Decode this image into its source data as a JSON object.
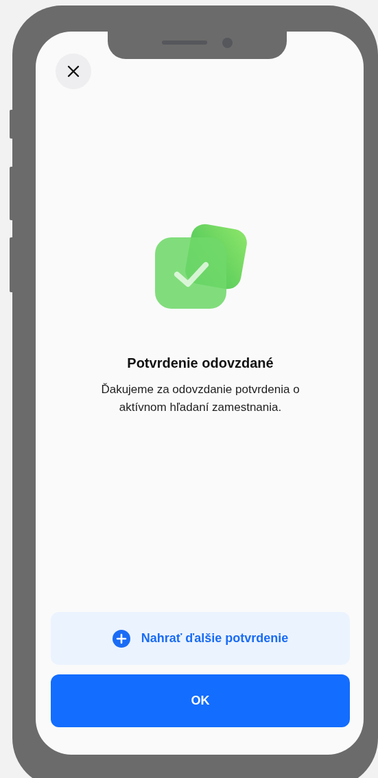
{
  "title": "Potvrdenie odovzdané",
  "message": "Ďakujeme za odovzdanie potvrdenia o aktívnom hľadaní zamestnania.",
  "buttons": [
    {
      "label": "Nahrať ďalšie potvrdenie",
      "kind": "secondary"
    },
    {
      "label": "OK",
      "kind": "primary"
    }
  ]
}
